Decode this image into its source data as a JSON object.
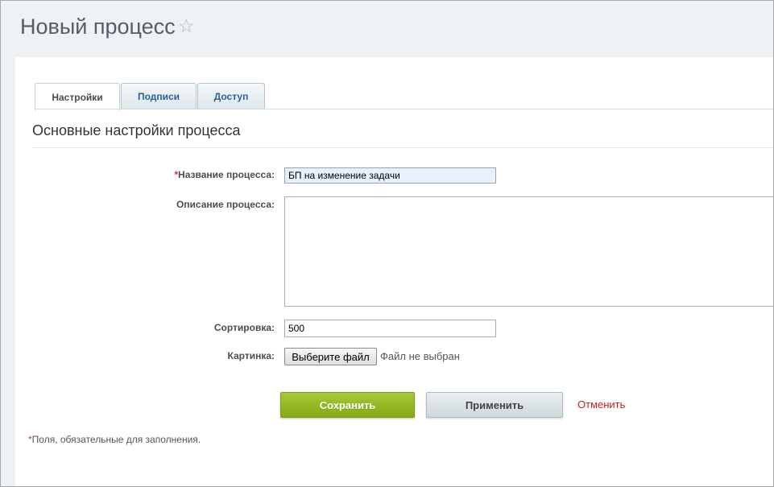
{
  "header": {
    "title": "Новый процесс",
    "favorite_icon": "star-icon",
    "favorite_glyph": "☆"
  },
  "tabs": [
    {
      "label": "Настройки",
      "active": true
    },
    {
      "label": "Подписи",
      "active": false
    },
    {
      "label": "Доступ",
      "active": false
    }
  ],
  "section": {
    "title": "Основные настройки процесса"
  },
  "form": {
    "required_marker": "*",
    "name": {
      "label": "Название процесса:",
      "value": "БП на изменение задачи",
      "required": true
    },
    "description": {
      "label": "Описание процесса:",
      "value": ""
    },
    "sort": {
      "label": "Сортировка:",
      "value": "500"
    },
    "picture": {
      "label": "Картинка:",
      "button_label": "Выберите файл",
      "status": "Файл не выбран"
    }
  },
  "actions": {
    "save_label": "Сохранить",
    "apply_label": "Применить",
    "cancel_label": "Отменить"
  },
  "footnote": {
    "marker": "*",
    "text": "Поля, обязательные для заполнения."
  },
  "colors": {
    "header_bg": "#eef2f4",
    "title_color": "#535c69",
    "save_button": "#93b826",
    "cancel_link": "#c41f1f",
    "required_marker": "#d32f2f",
    "tab_link": "#2b6199"
  }
}
